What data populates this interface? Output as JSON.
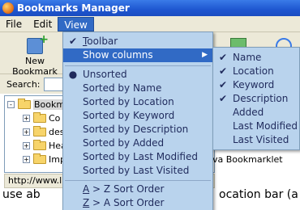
{
  "window": {
    "title": "Bookmarks Manager"
  },
  "menubar": {
    "items": [
      "File",
      "Edit",
      "View"
    ]
  },
  "toolbar": {
    "new_bookmark_label": "New Bookmark"
  },
  "search": {
    "label": "Search:",
    "value": ""
  },
  "tree": {
    "items": [
      {
        "label": "Bookmar",
        "expander": "-"
      },
      {
        "label": "Co",
        "expander": "+"
      },
      {
        "label": "des",
        "expander": "+"
      },
      {
        "label": "Hea",
        "expander": "+"
      },
      {
        "label": "Imp",
        "expander": "+"
      }
    ]
  },
  "statusbar": {
    "text": "http://www.l"
  },
  "rightpane": {
    "bookmarklet_text": "va Bookmarklet"
  },
  "page_text": {
    "line1": "use   ab",
    "line2": "ocation bar (a"
  },
  "view_menu": {
    "items": [
      {
        "label": "Toolbar",
        "checked": true,
        "underline": "T"
      },
      {
        "label": "Show columns",
        "submenu": true,
        "highlighted": true
      },
      {
        "label": "Unsorted",
        "radio": true
      },
      {
        "label": "Sorted by Name"
      },
      {
        "label": "Sorted by Location"
      },
      {
        "label": "Sorted by Keyword"
      },
      {
        "label": "Sorted by Description"
      },
      {
        "label": "Sorted by Added"
      },
      {
        "label": "Sorted by Last Modified"
      },
      {
        "label": "Sorted by Last Visited"
      },
      {
        "label": "A > Z Sort Order",
        "underline": "A"
      },
      {
        "label": "Z > A Sort Order",
        "underline": "Z"
      }
    ]
  },
  "columns_menu": {
    "items": [
      {
        "label": "Name",
        "checked": true
      },
      {
        "label": "Location",
        "checked": true
      },
      {
        "label": "Keyword",
        "checked": true
      },
      {
        "label": "Description",
        "checked": true
      },
      {
        "label": "Added",
        "checked": false
      },
      {
        "label": "Last Modified",
        "checked": false
      },
      {
        "label": "Last Visited",
        "checked": false
      }
    ]
  },
  "colors": {
    "title_bar": "#1e56d0",
    "menu_bg": "#b9d3ed",
    "highlight": "#316ac5"
  }
}
